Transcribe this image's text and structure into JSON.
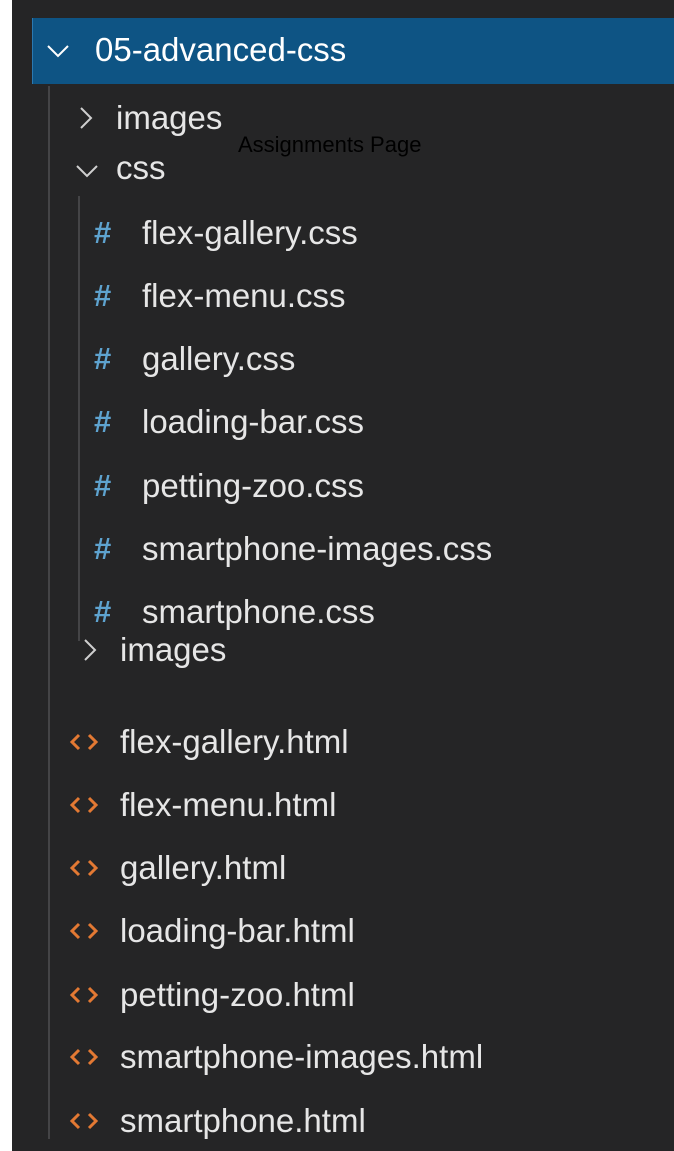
{
  "root_folder": {
    "label": "05-advanced-css",
    "icon": "chevron-down-icon"
  },
  "overlay_label": "Assignments Page",
  "tree": {
    "images_folder_1": {
      "label": "images",
      "icon": "chevron-right-icon"
    },
    "css_folder": {
      "label": "css",
      "icon": "chevron-down-icon"
    },
    "css_files": [
      {
        "label": "flex-gallery.css",
        "icon_text": "#"
      },
      {
        "label": "flex-menu.css",
        "icon_text": "#"
      },
      {
        "label": "gallery.css",
        "icon_text": "#"
      },
      {
        "label": "loading-bar.css",
        "icon_text": "#"
      },
      {
        "label": "petting-zoo.css",
        "icon_text": "#"
      },
      {
        "label": "smartphone-images.css",
        "icon_text": "#"
      },
      {
        "label": "smartphone.css",
        "icon_text": "#"
      }
    ],
    "images_folder_2": {
      "label": "images",
      "icon": "chevron-right-icon"
    },
    "html_files": [
      {
        "label": "flex-gallery.html",
        "icon": "html-file-icon"
      },
      {
        "label": "flex-menu.html",
        "icon": "html-file-icon"
      },
      {
        "label": "gallery.html",
        "icon": "html-file-icon"
      },
      {
        "label": "loading-bar.html",
        "icon": "html-file-icon"
      },
      {
        "label": "petting-zoo.html",
        "icon": "html-file-icon"
      },
      {
        "label": "smartphone-images.html",
        "icon": "html-file-icon"
      },
      {
        "label": "smartphone.html",
        "icon": "html-file-icon"
      }
    ]
  },
  "colors": {
    "panel_background": "#252526",
    "selected_row": "#0e5484",
    "css_icon": "#5ea3cf",
    "html_icon": "#e37933",
    "text": "#e6e6e6"
  }
}
